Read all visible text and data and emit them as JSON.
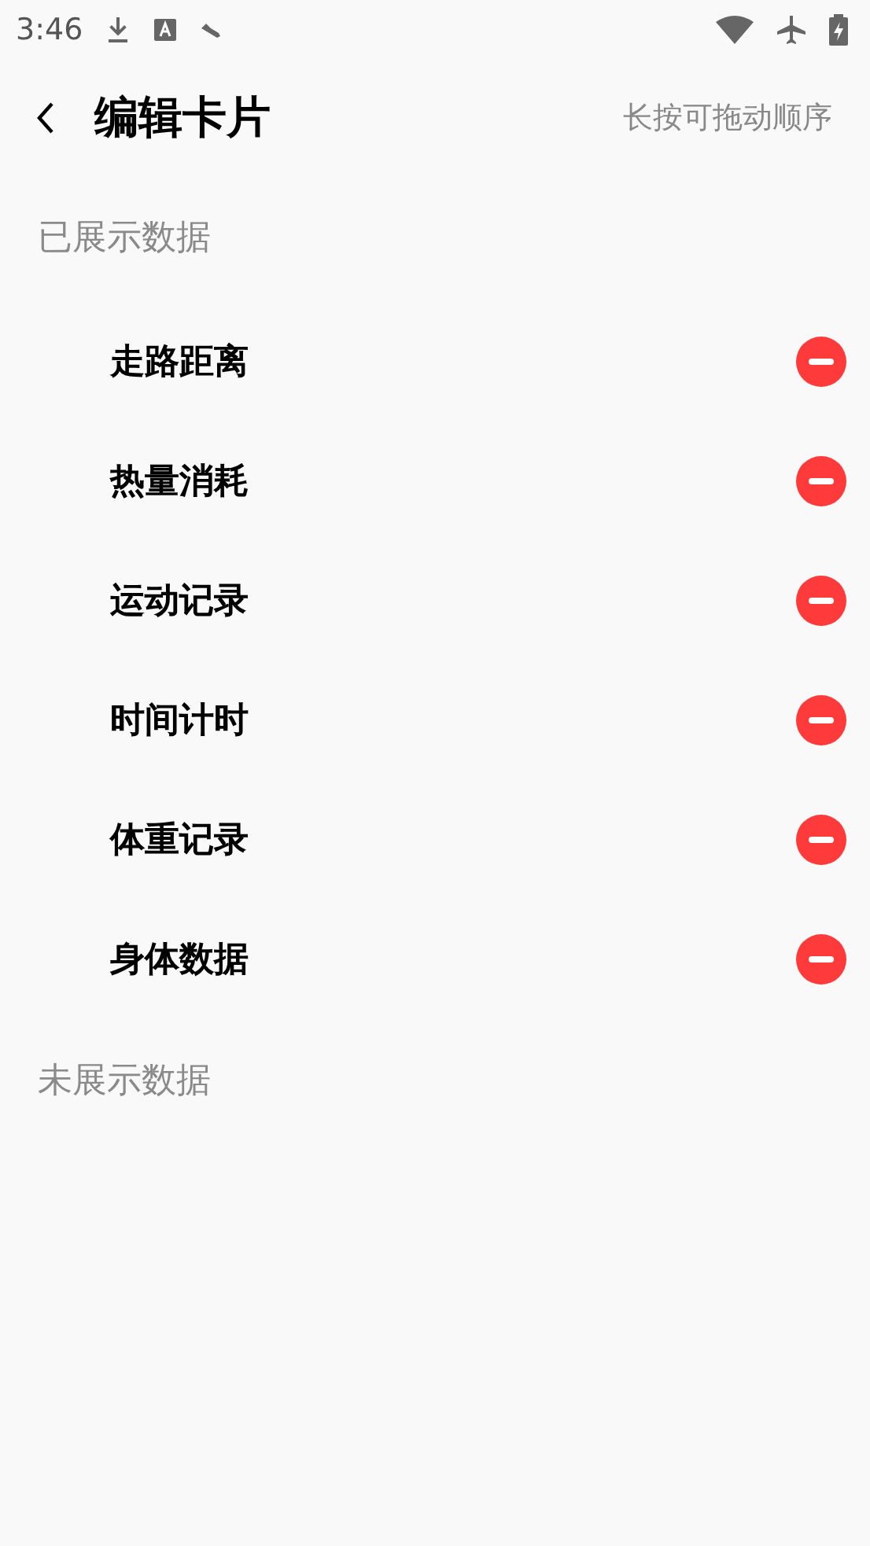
{
  "status_bar": {
    "time": "3:46"
  },
  "header": {
    "title": "编辑卡片",
    "hint": "长按可拖动顺序"
  },
  "sections": [
    {
      "title": "已展示数据",
      "items": [
        {
          "label": "走路距离"
        },
        {
          "label": "热量消耗"
        },
        {
          "label": "运动记录"
        },
        {
          "label": "时间计时"
        },
        {
          "label": "体重记录"
        },
        {
          "label": "身体数据"
        }
      ]
    },
    {
      "title": "未展示数据"
    }
  ]
}
